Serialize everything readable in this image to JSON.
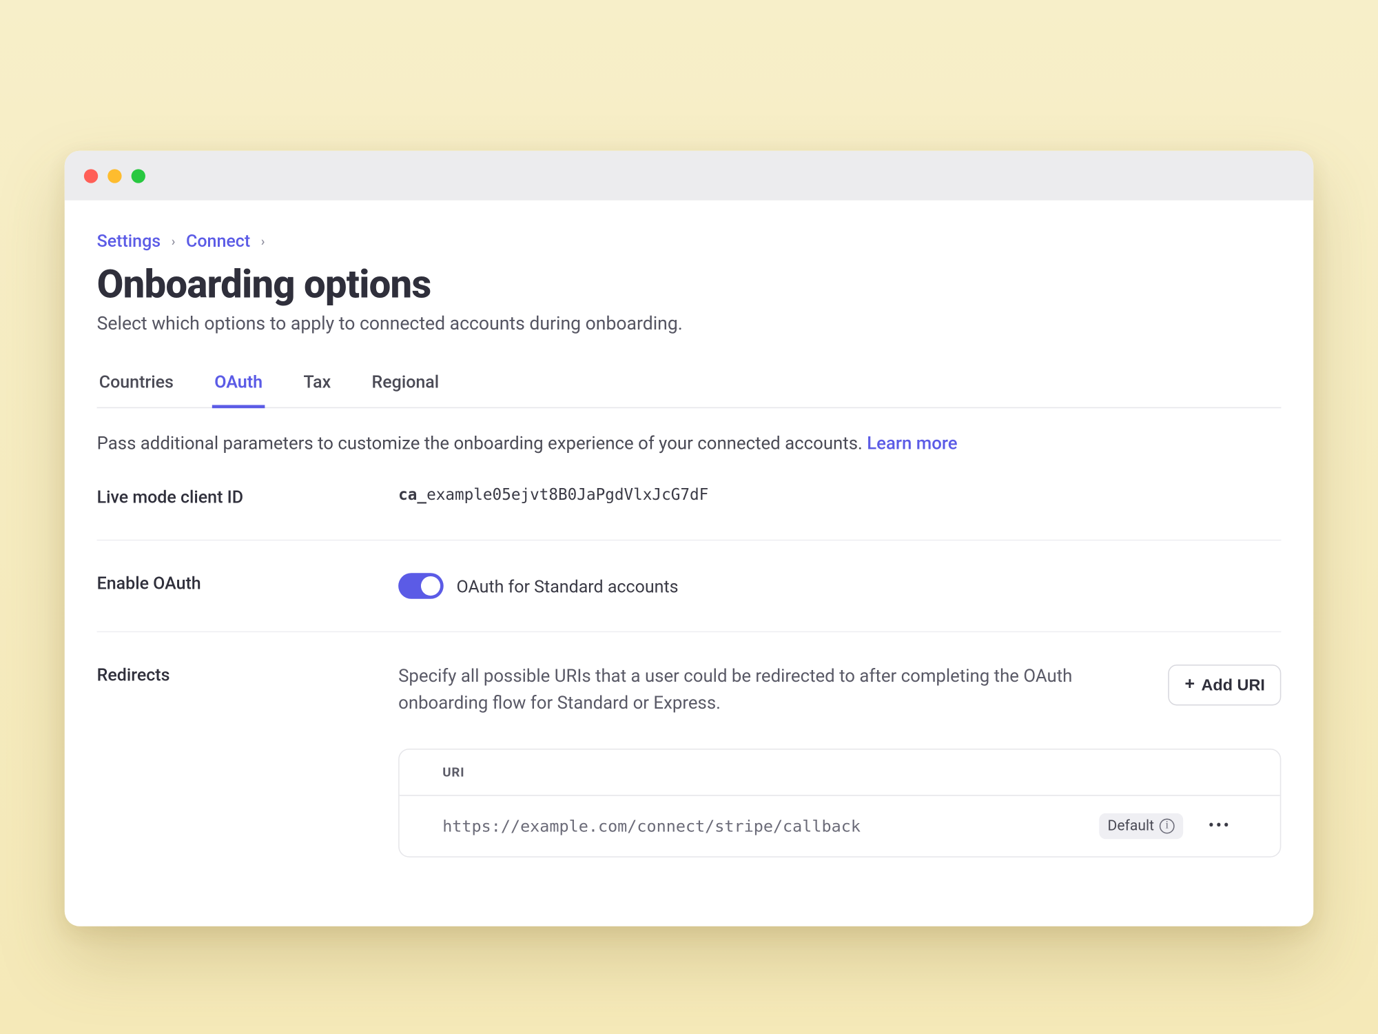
{
  "breadcrumb": {
    "root": "Settings",
    "section": "Connect"
  },
  "page": {
    "title": "Onboarding options",
    "subtitle": "Select which options to apply to connected accounts during onboarding."
  },
  "tabs": [
    {
      "label": "Countries",
      "active": false
    },
    {
      "label": "OAuth",
      "active": true
    },
    {
      "label": "Tax",
      "active": false
    },
    {
      "label": "Regional",
      "active": false
    }
  ],
  "pane": {
    "description": "Pass additional parameters to customize the onboarding experience of your connected accounts. ",
    "learn_more": "Learn more"
  },
  "client_id": {
    "label": "Live mode client ID",
    "prefix": "ca_",
    "value": "example05ejvt8B0JaPgdVlxJcG7dF"
  },
  "enable_oauth": {
    "label": "Enable OAuth",
    "toggle_label": "OAuth for Standard accounts",
    "enabled": true
  },
  "redirects": {
    "label": "Redirects",
    "description": "Specify all possible URIs that a user could be redirected to after completing the OAuth onboarding flow for Standard or Express.",
    "add_button": "Add URI",
    "column_header": "URI",
    "items": [
      {
        "uri": "https://example.com/connect/stripe/callback",
        "default_badge": "Default"
      }
    ]
  }
}
